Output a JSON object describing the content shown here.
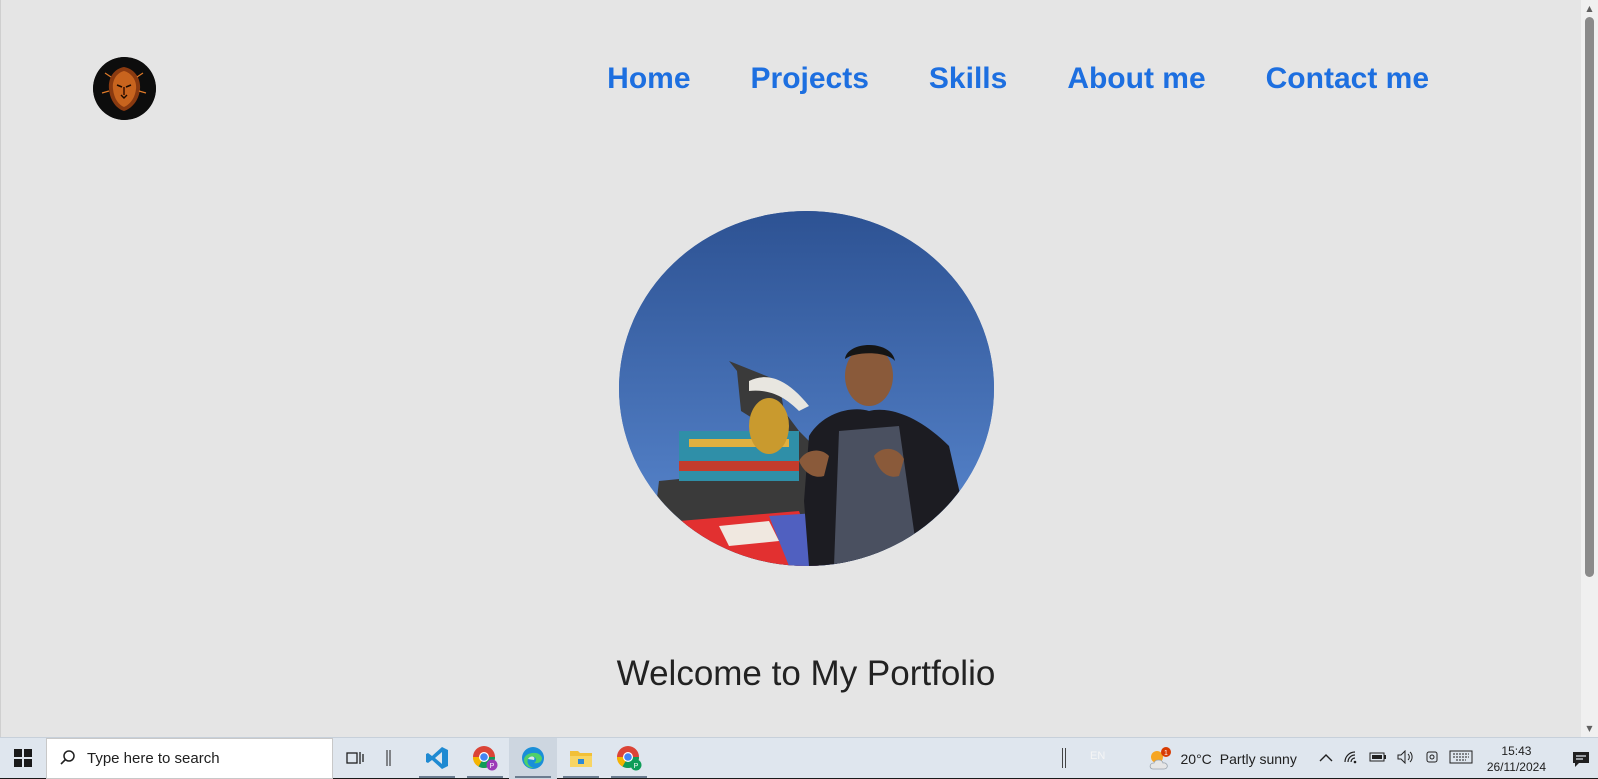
{
  "nav": {
    "items": [
      {
        "label": "Home"
      },
      {
        "label": "Projects"
      },
      {
        "label": "Skills"
      },
      {
        "label": "About me"
      },
      {
        "label": "Contact me"
      }
    ]
  },
  "hero": {
    "welcome": "Welcome to My Portfolio"
  },
  "taskbar": {
    "search_placeholder": "Type here to search",
    "language": "EN",
    "weather": {
      "badge": "1",
      "temperature": "20°C",
      "condition": "Partly sunny"
    },
    "clock": {
      "time": "15:43",
      "date": "26/11/2024"
    },
    "apps": [
      {
        "icon": "task-view-icon"
      },
      {
        "icon": "vscode-icon"
      },
      {
        "icon": "chrome-profile-icon"
      },
      {
        "icon": "edge-icon"
      },
      {
        "icon": "file-explorer-icon"
      },
      {
        "icon": "chrome-profile-icon"
      }
    ]
  },
  "colors": {
    "nav_link": "#1d6fe0",
    "page_bg": "#e5e5e5",
    "taskbar_bg": "#dfe6ee"
  }
}
